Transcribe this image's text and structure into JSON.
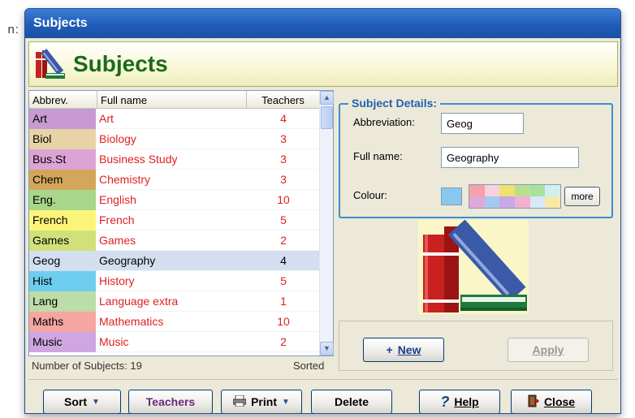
{
  "background_fragment": "n:",
  "window": {
    "title": "Subjects"
  },
  "header": {
    "title": "Subjects"
  },
  "list": {
    "columns": [
      "Abbrev.",
      "Full name",
      "Teachers"
    ],
    "rows": [
      {
        "abbrev": "Art",
        "full": "Art",
        "teachers": "4",
        "color": "#c79ad2"
      },
      {
        "abbrev": "Biol",
        "full": "Biology",
        "teachers": "3",
        "color": "#e8d3a6"
      },
      {
        "abbrev": "Bus.St",
        "full": "Business Study",
        "teachers": "3",
        "color": "#dca4d6"
      },
      {
        "abbrev": "Chem",
        "full": "Chemistry",
        "teachers": "3",
        "color": "#d4a65a"
      },
      {
        "abbrev": "Eng.",
        "full": "English",
        "teachers": "10",
        "color": "#a8d68a"
      },
      {
        "abbrev": "French",
        "full": "French",
        "teachers": "5",
        "color": "#fbf67a"
      },
      {
        "abbrev": "Games",
        "full": "Games",
        "teachers": "2",
        "color": "#d2e07a"
      },
      {
        "abbrev": "Geog",
        "full": "Geography",
        "teachers": "4",
        "color": "#d3dff0",
        "selected": true
      },
      {
        "abbrev": "Hist",
        "full": "History",
        "teachers": "5",
        "color": "#6ecdee"
      },
      {
        "abbrev": "Lang",
        "full": "Language extra",
        "teachers": "1",
        "color": "#bcdca8"
      },
      {
        "abbrev": "Maths",
        "full": "Mathematics",
        "teachers": "10",
        "color": "#f5a6a0"
      },
      {
        "abbrev": "Music",
        "full": "Music",
        "teachers": "2",
        "color": "#cfa6e0"
      }
    ],
    "count_label": "Number of Subjects: 19",
    "sorted_label": "Sorted"
  },
  "details": {
    "title": "Subject Details:",
    "abbrev_label": "Abbreviation:",
    "abbrev_value": "Geog",
    "fullname_label": "Full name:",
    "fullname_value": "Geography",
    "colour_label": "Colour:",
    "colour_value": "#88c8ee",
    "palette": [
      "#f7a0a8",
      "#f9d0e0",
      "#f0e070",
      "#b8e090",
      "#a8e0a0",
      "#d0f0f0",
      "#e0a8d8",
      "#a8c8f0",
      "#c8a8e8",
      "#f0b0d0",
      "#d8e8f8",
      "#f8e8a8"
    ],
    "more_label": "more"
  },
  "actions": {
    "new_label": "New",
    "apply_label": "Apply"
  },
  "toolbar": {
    "sort_label": "Sort",
    "teachers_label": "Teachers",
    "print_label": "Print",
    "delete_label": "Delete",
    "help_label": "Help",
    "close_label": "Close"
  }
}
